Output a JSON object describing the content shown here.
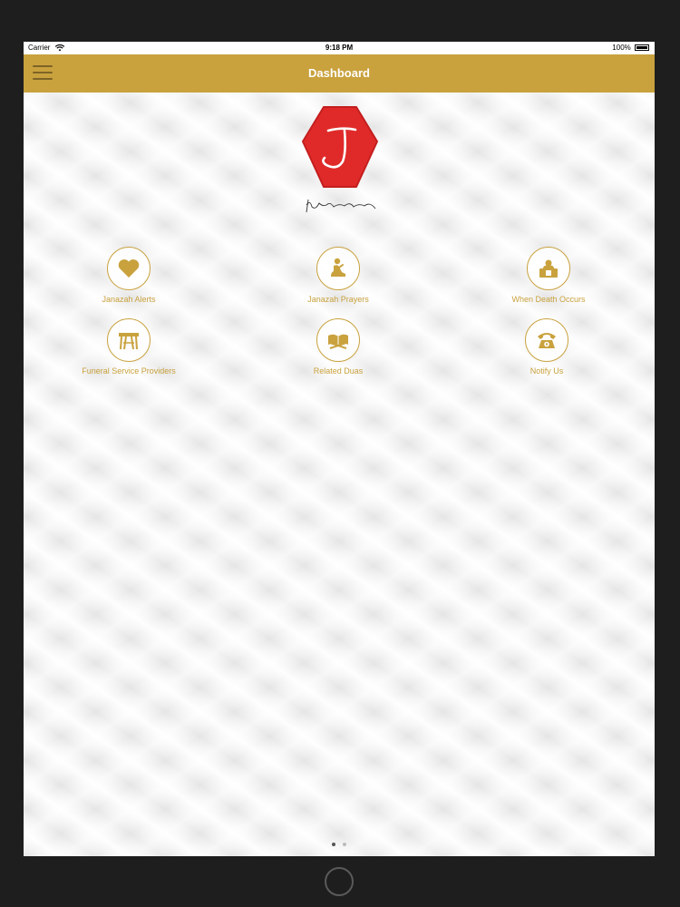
{
  "status_bar": {
    "carrier": "Carrier",
    "time": "9:18 PM",
    "battery": "100%"
  },
  "nav_bar": {
    "title": "Dashboard",
    "menu_icon": "hamburger-icon",
    "color": "#c9a23e"
  },
  "logo": {
    "letter": "J",
    "caption": "Janaazah Collective Sy",
    "color": "#e02a2a"
  },
  "menu": {
    "items": [
      {
        "label": "Janazah Alerts",
        "icon": "heart-icon"
      },
      {
        "label": "Janazah Prayers",
        "icon": "praying-person-icon"
      },
      {
        "label": "When Death Occurs",
        "icon": "person-box-icon"
      },
      {
        "label": "Funeral Service Providers",
        "icon": "bier-icon"
      },
      {
        "label": "Related Duas",
        "icon": "quran-stand-icon"
      },
      {
        "label": "Notify Us",
        "icon": "telephone-icon"
      }
    ]
  },
  "pagination": {
    "current": 1,
    "total": 2
  },
  "accent_color": "#c9a23e"
}
